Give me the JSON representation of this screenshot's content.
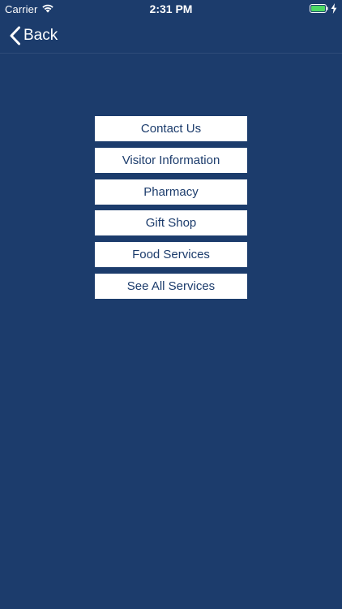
{
  "status_bar": {
    "carrier": "Carrier",
    "time": "2:31 PM",
    "battery_color": "#4cd964"
  },
  "nav": {
    "back_label": "Back"
  },
  "menu": {
    "items": [
      {
        "label": "Contact Us"
      },
      {
        "label": "Visitor Information"
      },
      {
        "label": "Pharmacy"
      },
      {
        "label": "Gift Shop"
      },
      {
        "label": "Food Services"
      },
      {
        "label": "See All Services"
      }
    ]
  },
  "colors": {
    "background": "#1c3c6c",
    "button_background": "#ffffff",
    "button_text": "#1c3c6c"
  }
}
